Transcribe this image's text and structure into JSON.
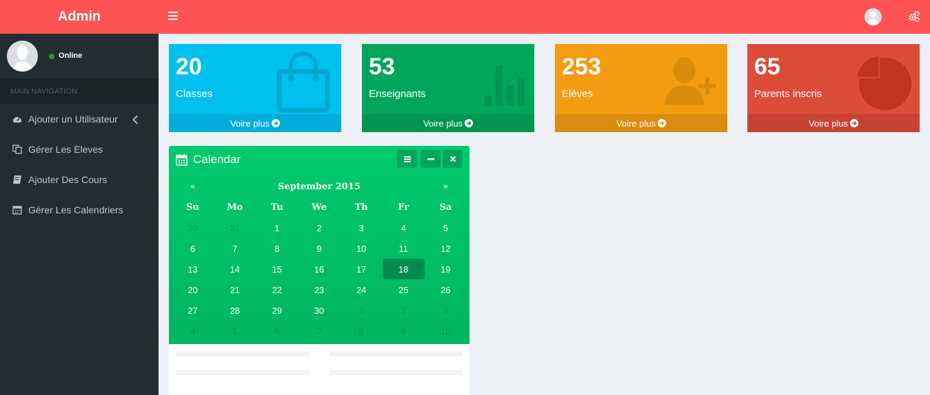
{
  "header": {
    "brand": "Admin",
    "color": "#ff5252",
    "menu_icon": "bars-icon",
    "settings_icon": "gears-icon"
  },
  "sidebar": {
    "user_status": "Online",
    "nav_header": "MAIN NAVIGATION",
    "items": [
      {
        "label": "Ajouter un Utilisateur",
        "icon": "dashboard-icon"
      },
      {
        "label": "Gérer Les Eleves",
        "icon": "copy-icon"
      },
      {
        "label": "Ajouter Des Cours",
        "icon": "book-icon"
      },
      {
        "label": "Gérer Les Calendriers",
        "icon": "calendar-icon"
      }
    ]
  },
  "boxes": [
    {
      "value": "20",
      "label": "Classes",
      "link": "Voire plus",
      "icon": "shopping-bag-icon",
      "color": "#00c0ef"
    },
    {
      "value": "53",
      "label": "Enseignants",
      "link": "Voire plus",
      "icon": "bar-chart-icon",
      "color": "#00a65a"
    },
    {
      "value": "253",
      "label": "Elèves",
      "link": "Voire plus",
      "icon": "user-plus-icon",
      "color": "#f39c12"
    },
    {
      "value": "65",
      "label": "Parents inscris",
      "link": "Voire plus",
      "icon": "pie-chart-icon",
      "color": "#dd4b39"
    }
  ],
  "calendar": {
    "title": "Calendar",
    "prev": "«",
    "next": "»",
    "month": "September 2015",
    "weekdays": [
      "Su",
      "Mo",
      "Tu",
      "We",
      "Th",
      "Fr",
      "Sa"
    ],
    "weeks": [
      [
        "30",
        "31",
        "1",
        "2",
        "3",
        "4",
        "5"
      ],
      [
        "6",
        "7",
        "8",
        "9",
        "10",
        "11",
        "12"
      ],
      [
        "13",
        "14",
        "15",
        "16",
        "17",
        "18",
        "19"
      ],
      [
        "20",
        "21",
        "22",
        "23",
        "24",
        "25",
        "26"
      ],
      [
        "27",
        "28",
        "29",
        "30",
        "1",
        "2",
        "3"
      ],
      [
        "4",
        "5",
        "6",
        "7",
        "8",
        "9",
        "10"
      ]
    ],
    "selected": "18"
  }
}
